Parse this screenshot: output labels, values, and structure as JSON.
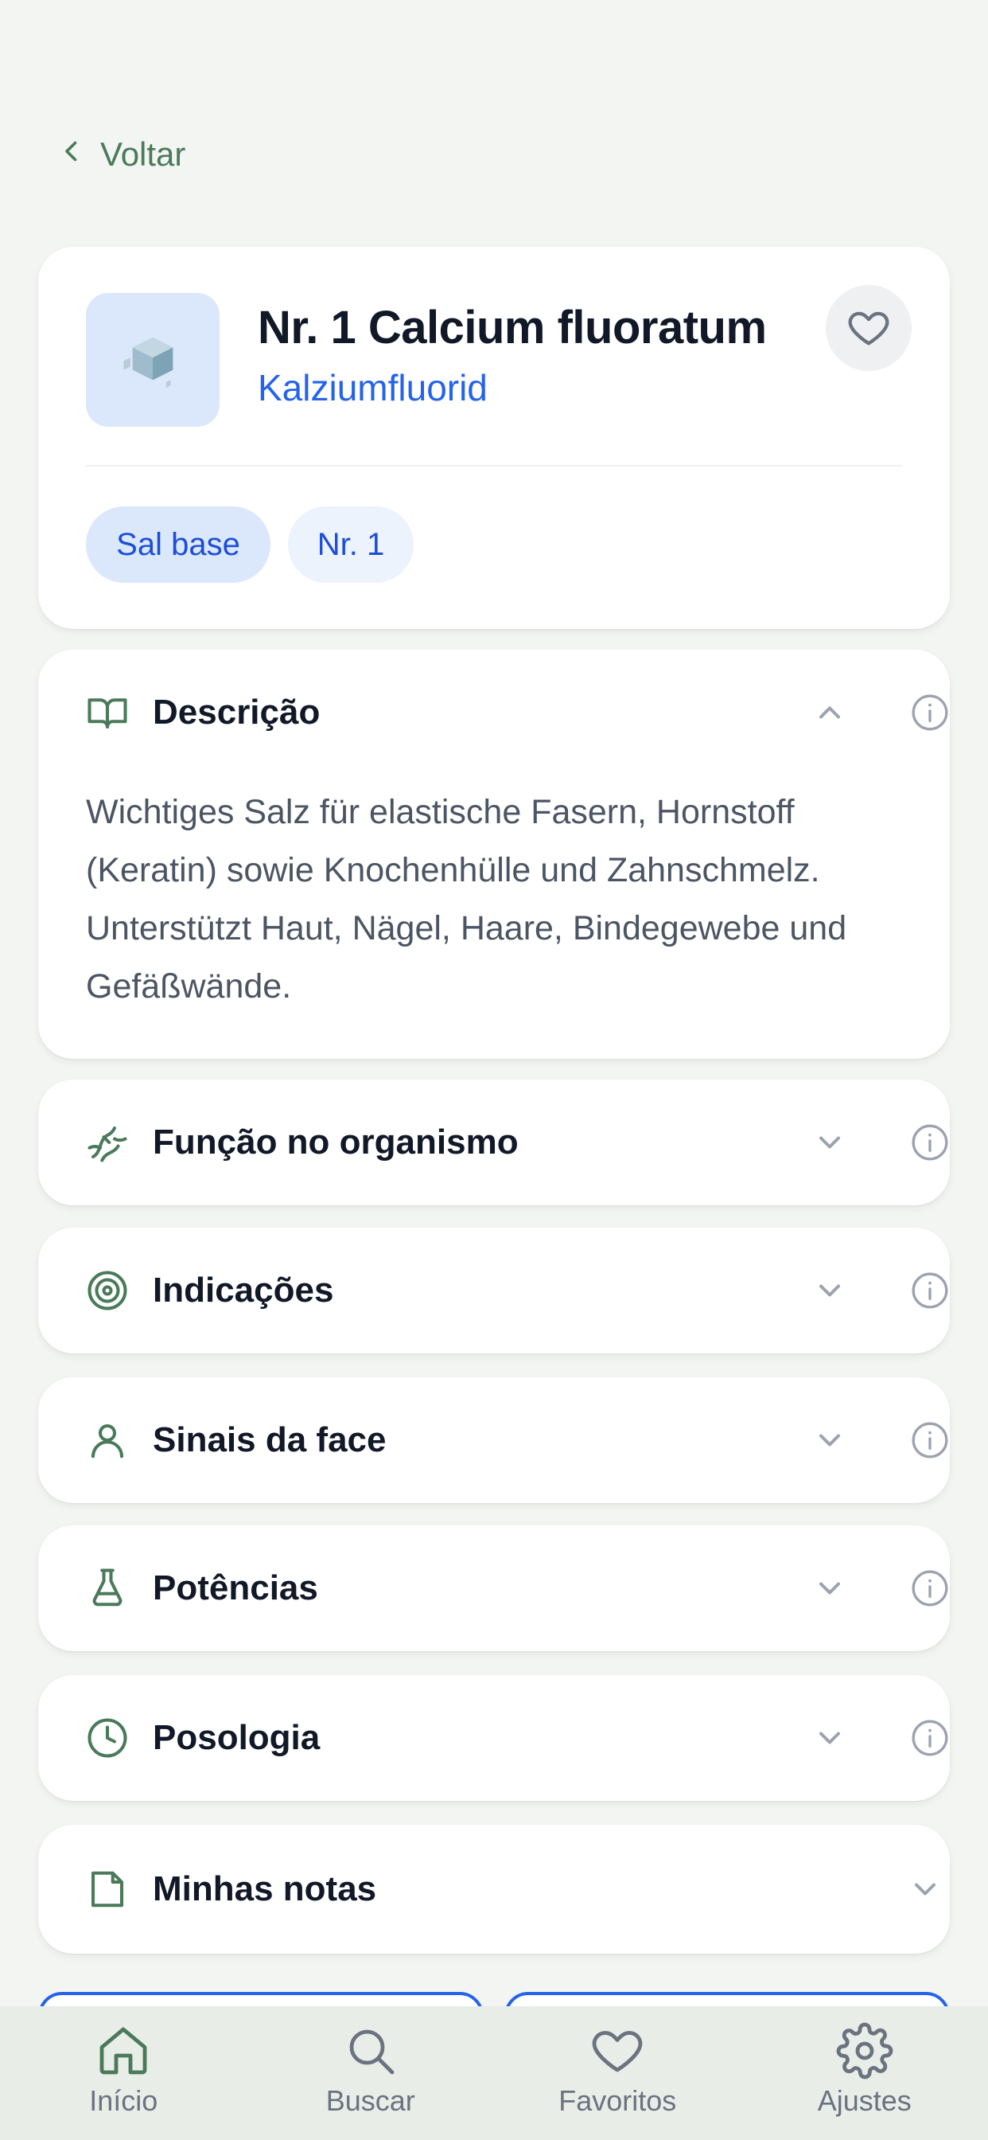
{
  "back_label": "Voltar",
  "salt": {
    "title": "Nr. 1 Calcium fluoratum",
    "subtitle": "Kalziumfluorid",
    "chips": [
      "Sal base",
      "Nr. 1"
    ]
  },
  "sections": {
    "description": {
      "title": "Descrição",
      "text": "Wichtiges Salz für elastische Fasern, Hornstoff (Keratin) sowie Knochenhülle und Zahnschmelz. Unterstützt Haut, Nägel, Haare, Bindegewebe und Gefäßwände."
    },
    "function": {
      "title": "Função no organismo"
    },
    "indications": {
      "title": "Indicações"
    },
    "face_signs": {
      "title": "Sinais da face"
    },
    "potencies": {
      "title": "Potências"
    },
    "dosage": {
      "title": "Posologia"
    },
    "notes": {
      "title": "Minhas notas"
    }
  },
  "tabbar": {
    "home": "Início",
    "search": "Buscar",
    "favorites": "Favoritos",
    "settings": "Ajustes"
  },
  "colors": {
    "accent_green": "#4a7a5a",
    "link_blue": "#2563eb",
    "chip_bg": "#dbe8fb",
    "background": "#f3f5f2"
  },
  "icons": {
    "description": "book-open-icon",
    "function": "dna-icon",
    "indications": "target-icon",
    "face_signs": "user-icon",
    "potencies": "flask-icon",
    "dosage": "clock-icon",
    "notes": "file-icon"
  }
}
